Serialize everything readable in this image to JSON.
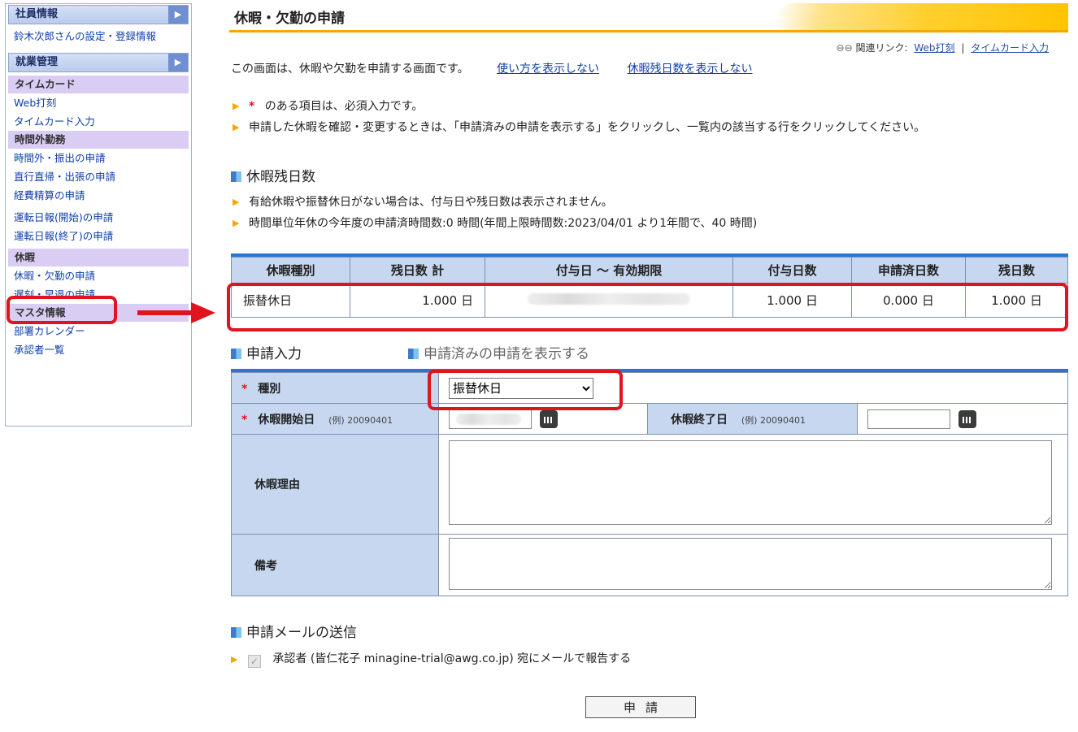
{
  "sidebar": {
    "section1_title": "社員情報",
    "user_link": "鈴木次郎さんの設定・登録情報",
    "section2_title": "就業管理",
    "cat_timecard": "タイムカード",
    "web_clock": "Web打刻",
    "timecard_input": "タイムカード入力",
    "cat_overtime": "時間外勤務",
    "overtime_request": "時間外・振出の申請",
    "direct_request": "直行直帰・出張の申請",
    "expense_request": "経費精算の申請",
    "daily_start": "運転日報(開始)の申請",
    "daily_end": "運転日報(終了)の申請",
    "cat_leave": "休暇",
    "leave_request": "休暇・欠勤の申請",
    "late_request": "遅刻・早退の申請",
    "cat_master": "マスタ情報",
    "dept_calendar": "部署カレンダー",
    "approver_list": "承認者一覧"
  },
  "header": {
    "title": "休暇・欠勤の申請",
    "related_label": "関連リンク:",
    "related_web_clock": "Web打刻",
    "related_separator": "|",
    "related_timecard": "タイムカード入力"
  },
  "intro": {
    "text": "この画面は、休暇や欠勤を申請する画面です。",
    "hide_usage": "使い方を表示しない",
    "hide_balance": "休暇残日数を表示しない"
  },
  "notes": {
    "required_mark": "*",
    "required_text": "のある項目は、必須入力です。",
    "confirm_text": "申請した休暇を確認・変更するときは、「申請済みの申請を表示する」をクリックし、一覧内の該当する行をクリックしてください。"
  },
  "balance": {
    "title": "休暇残日数",
    "note1": "有給休暇や振替休日がない場合は、付与日や残日数は表示されません。",
    "note2": "時間単位年休の今年度の申請済時間数:0 時間(年間上限時間数:2023/04/01 より1年間で、40 時間)",
    "headers": [
      "休暇種別",
      "残日数 計",
      "付与日 〜 有効期限",
      "付与日数",
      "申請済日数",
      "残日数"
    ],
    "row": {
      "type": "振替休日",
      "total": "1.000 日",
      "granted": "1.000 日",
      "applied": "0.000 日",
      "remaining": "1.000 日"
    }
  },
  "form": {
    "title": "申請入力",
    "show_applied": "申請済みの申請を表示する",
    "required_mark": "*",
    "kind_label": "種別",
    "kind_value": "振替休日",
    "start_label": "休暇開始日",
    "start_example": "(例) 20090401",
    "end_label": "休暇終了日",
    "end_example": "(例) 20090401",
    "reason_label": "休暇理由",
    "remarks_label": "備考"
  },
  "mail": {
    "title": "申請メールの送信",
    "text": "承認者 (皆仁花子 minagine-trial@awg.co.jp) 宛にメールで報告する"
  },
  "submit_label": "申請",
  "colors": {
    "accent_blue": "#2b74d3",
    "header_orange": "#f5a900",
    "annotation_red": "#e0141e"
  }
}
